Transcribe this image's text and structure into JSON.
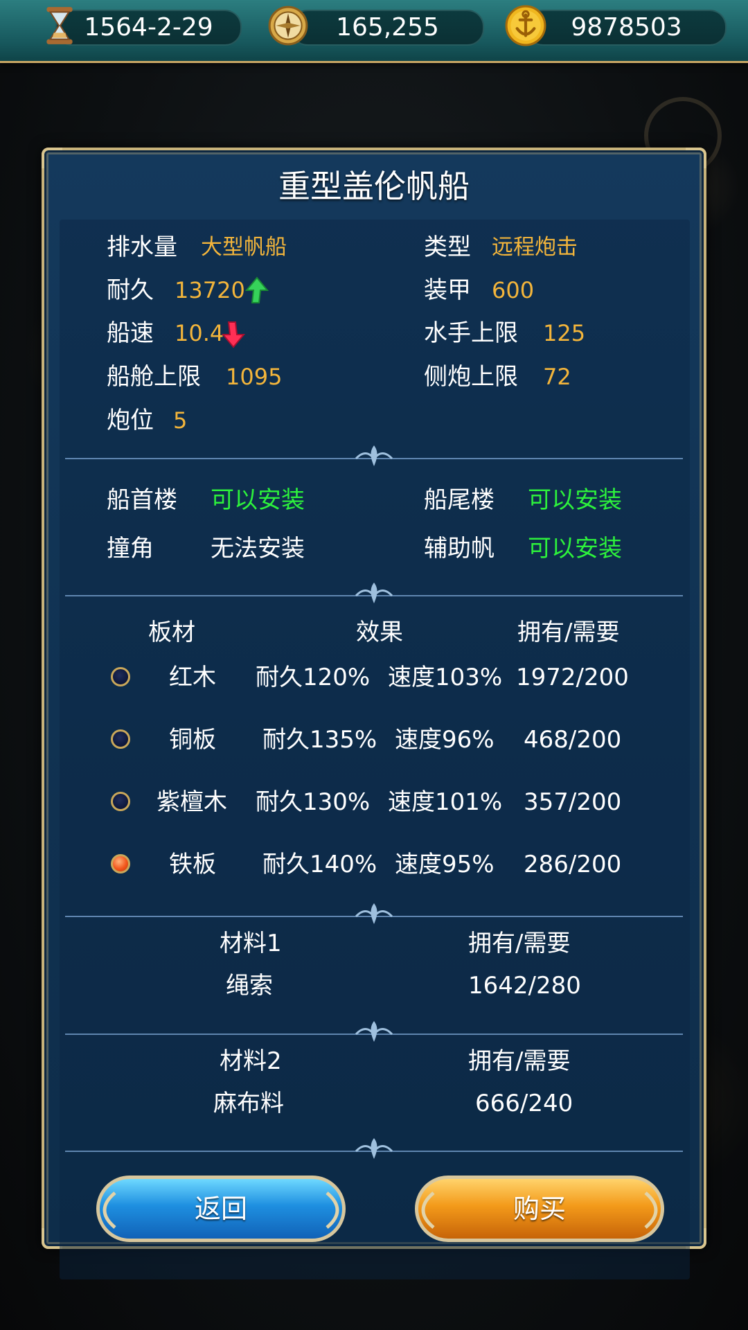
{
  "topbar": {
    "date": "1564-2-29",
    "compass_value": "165,255",
    "gold": "9878503",
    "icons": [
      "hourglass-icon",
      "compass-icon",
      "anchor-coin-icon"
    ]
  },
  "ship": {
    "title": "重型盖伦帆船"
  },
  "stats": {
    "displacement_label": "排水量",
    "displacement_value": "大型帆船",
    "type_label": "类型",
    "type_value": "远程炮击",
    "durability_label": "耐久",
    "durability_value": "13720",
    "armor_label": "装甲",
    "armor_value": "600",
    "speed_label": "船速",
    "speed_value": "10.4",
    "crew_label": "水手上限",
    "crew_value": "125",
    "cargo_label": "船舱上限",
    "cargo_value": "1095",
    "broadside_label": "侧炮上限",
    "broadside_value": "72",
    "cannon_label": "炮位",
    "cannon_value": "5"
  },
  "equipment": {
    "bow_label": "船首楼",
    "bow_value": "可以安装",
    "stern_label": "船尾楼",
    "stern_value": "可以安装",
    "ram_label": "撞角",
    "ram_value": "无法安装",
    "aux_sail_label": "辅助帆",
    "aux_sail_value": "可以安装"
  },
  "planks": {
    "headers": {
      "material": "板材",
      "effect": "效果",
      "own": "拥有/需要"
    },
    "rows": [
      {
        "name": "红木",
        "durability": "耐久120%",
        "speed": "速度103%",
        "own": "1972/200",
        "selected": false
      },
      {
        "name": "铜板",
        "durability": "耐久135%",
        "speed": "速度96%",
        "own": "468/200",
        "selected": false
      },
      {
        "name": "紫檀木",
        "durability": "耐久130%",
        "speed": "速度101%",
        "own": "357/200",
        "selected": false
      },
      {
        "name": "铁板",
        "durability": "耐久140%",
        "speed": "速度95%",
        "own": "286/200",
        "selected": true
      }
    ]
  },
  "material1": {
    "header": "材料1",
    "own_header": "拥有/需要",
    "name": "绳索",
    "own": "1642/280"
  },
  "material2": {
    "header": "材料2",
    "own_header": "拥有/需要",
    "name": "麻布料",
    "own": "666/240"
  },
  "buttons": {
    "back": "返回",
    "buy": "购买"
  },
  "colors": {
    "highlight": "#f3b53b",
    "installable": "#2df13c",
    "panel": "#12365a",
    "frame": "#c7b27a"
  }
}
